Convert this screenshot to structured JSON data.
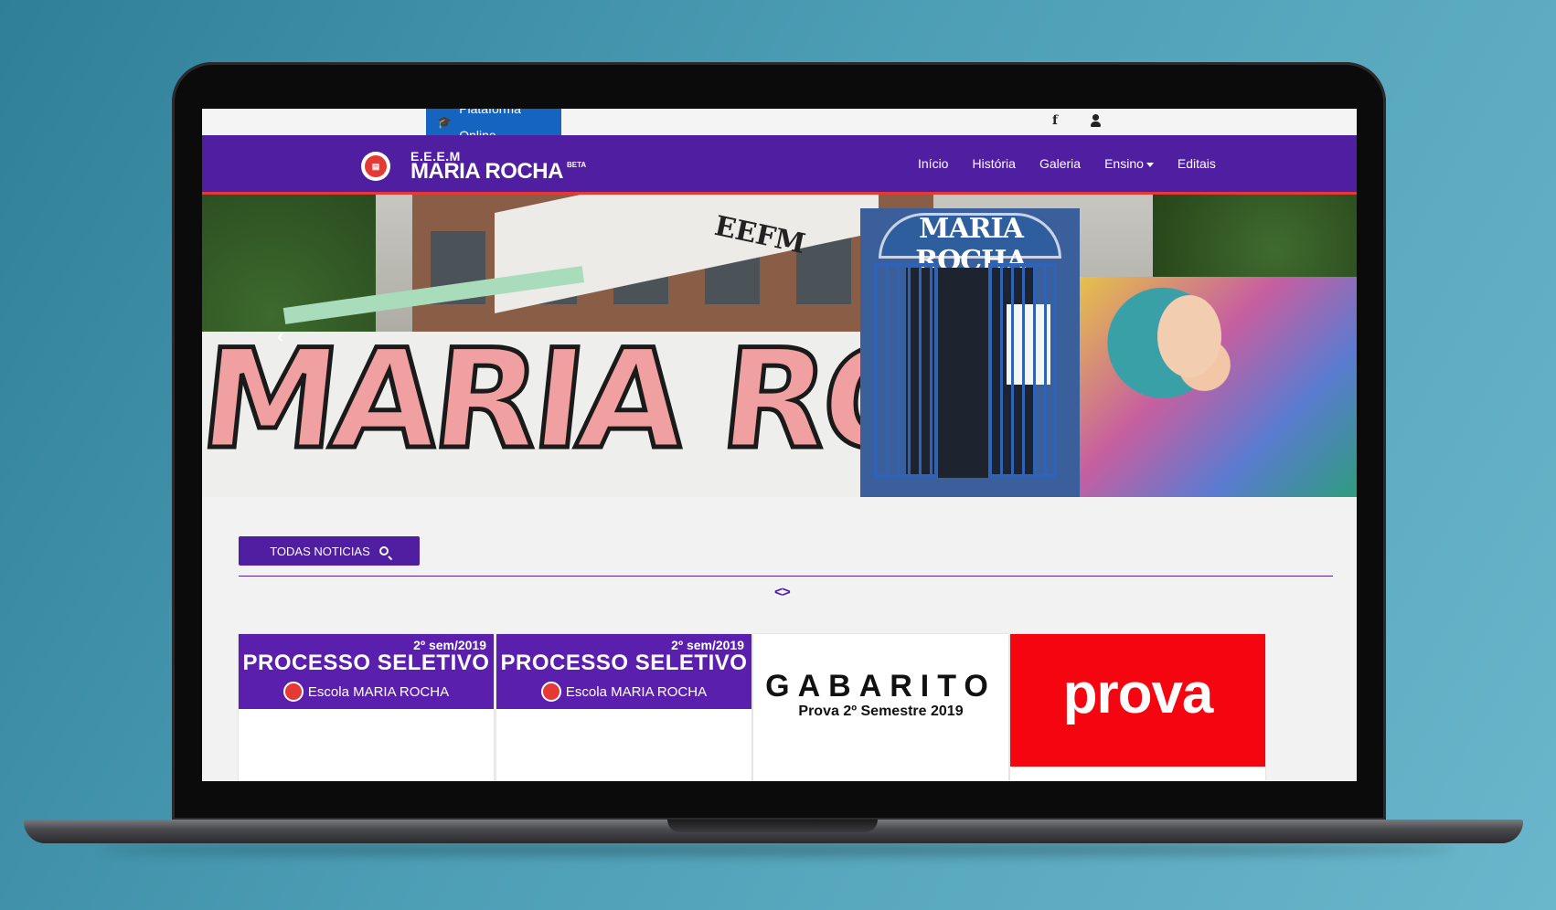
{
  "topbar": {
    "platform_label": "Plataforma Online",
    "facebook_glyph": "f",
    "icons": [
      "graduation-cap-icon",
      "facebook-icon",
      "user-icon"
    ]
  },
  "navbar": {
    "brand_small": "E.E.E.M",
    "brand_name": "MARIA ROCHA",
    "brand_beta": "BETA",
    "links": [
      "Início",
      "História",
      "Galeria",
      "Ensino",
      "Editais"
    ],
    "colors": {
      "primary": "#4f1ea1",
      "accent": "#e53935",
      "platform": "#1565c0"
    }
  },
  "hero": {
    "graffiti_text": "MARIA ROCHA",
    "gate_sign": "MARIA ROCHA",
    "prev_glyph": "‹"
  },
  "news": {
    "button_label": "TODAS NOTICIAS",
    "arrows": "<>"
  },
  "cards": [
    {
      "semester": "2º sem/2019",
      "title": "PROCESSO SELETIVO",
      "subtitle": "Escola MARIA ROCHA"
    },
    {
      "semester": "2º sem/2019",
      "title": "PROCESSO SELETIVO",
      "subtitle": "Escola MARIA ROCHA"
    },
    {
      "title": "GABARITO",
      "subtitle": "Prova 2º Semestre 2019"
    },
    {
      "title": "prova"
    }
  ]
}
